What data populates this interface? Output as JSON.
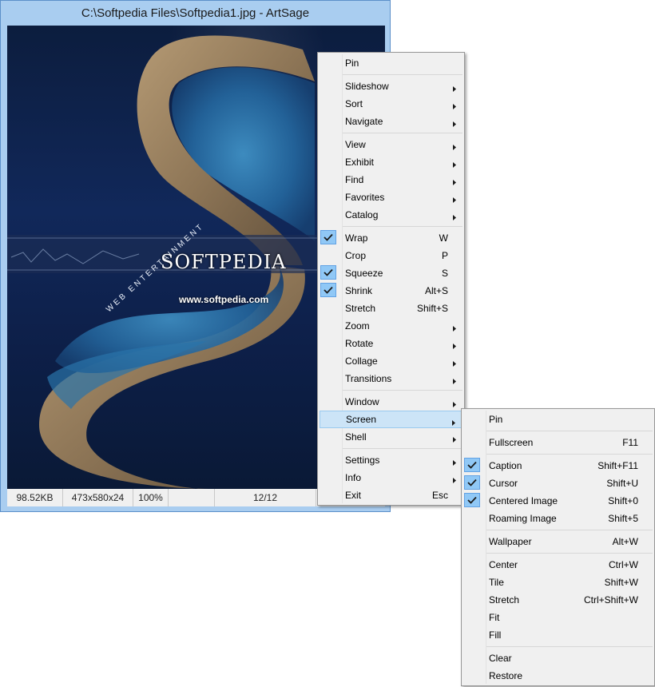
{
  "window": {
    "title": "C:\\Softpedia Files\\Softpedia1.jpg - ArtSage"
  },
  "image": {
    "brand": "SOFTPEDIA",
    "url": "www.softpedia.com",
    "tag": "WEB ENTERTAINMENT"
  },
  "statusbar": {
    "size": "98.52KB",
    "dimensions": "473x580x24",
    "zoom": "100%",
    "blank": "",
    "index": "12/12",
    "extra": "!"
  },
  "main_menu": {
    "items": [
      {
        "label": "Pin",
        "accel": "",
        "submenu": false,
        "checked": false
      },
      {
        "sep": true
      },
      {
        "label": "Slideshow",
        "accel": "",
        "submenu": true,
        "checked": false
      },
      {
        "label": "Sort",
        "accel": "",
        "submenu": true,
        "checked": false
      },
      {
        "label": "Navigate",
        "accel": "",
        "submenu": true,
        "checked": false
      },
      {
        "sep": true
      },
      {
        "label": "View",
        "accel": "",
        "submenu": true,
        "checked": false
      },
      {
        "label": "Exhibit",
        "accel": "",
        "submenu": true,
        "checked": false
      },
      {
        "label": "Find",
        "accel": "",
        "submenu": true,
        "checked": false
      },
      {
        "label": "Favorites",
        "accel": "",
        "submenu": true,
        "checked": false
      },
      {
        "label": "Catalog",
        "accel": "",
        "submenu": true,
        "checked": false
      },
      {
        "sep": true
      },
      {
        "label": "Wrap",
        "accel": "W",
        "submenu": false,
        "checked": true
      },
      {
        "label": "Crop",
        "accel": "P",
        "submenu": false,
        "checked": false
      },
      {
        "label": "Squeeze",
        "accel": "S",
        "submenu": false,
        "checked": true
      },
      {
        "label": "Shrink",
        "accel": "Alt+S",
        "submenu": false,
        "checked": true
      },
      {
        "label": "Stretch",
        "accel": "Shift+S",
        "submenu": false,
        "checked": false
      },
      {
        "label": "Zoom",
        "accel": "",
        "submenu": true,
        "checked": false
      },
      {
        "label": "Rotate",
        "accel": "",
        "submenu": true,
        "checked": false
      },
      {
        "label": "Collage",
        "accel": "",
        "submenu": true,
        "checked": false
      },
      {
        "label": "Transitions",
        "accel": "",
        "submenu": true,
        "checked": false
      },
      {
        "sep": true
      },
      {
        "label": "Window",
        "accel": "",
        "submenu": true,
        "checked": false
      },
      {
        "label": "Screen",
        "accel": "",
        "submenu": true,
        "checked": false,
        "selected": true
      },
      {
        "label": "Shell",
        "accel": "",
        "submenu": true,
        "checked": false
      },
      {
        "sep": true
      },
      {
        "label": "Settings",
        "accel": "",
        "submenu": true,
        "checked": false
      },
      {
        "label": "Info",
        "accel": "",
        "submenu": true,
        "checked": false
      },
      {
        "label": "Exit",
        "accel": "Esc",
        "submenu": false,
        "checked": false
      }
    ]
  },
  "screen_menu": {
    "items": [
      {
        "label": "Pin",
        "accel": "",
        "checked": false
      },
      {
        "sep": true
      },
      {
        "label": "Fullscreen",
        "accel": "F11",
        "checked": false
      },
      {
        "sep": true
      },
      {
        "label": "Caption",
        "accel": "Shift+F11",
        "checked": true
      },
      {
        "label": "Cursor",
        "accel": "Shift+U",
        "checked": true
      },
      {
        "label": "Centered Image",
        "accel": "Shift+0",
        "checked": true
      },
      {
        "label": "Roaming Image",
        "accel": "Shift+5",
        "checked": false
      },
      {
        "sep": true
      },
      {
        "label": "Wallpaper",
        "accel": "Alt+W",
        "checked": false
      },
      {
        "sep": true
      },
      {
        "label": "Center",
        "accel": "Ctrl+W",
        "checked": false
      },
      {
        "label": "Tile",
        "accel": "Shift+W",
        "checked": false
      },
      {
        "label": "Stretch",
        "accel": "Ctrl+Shift+W",
        "checked": false
      },
      {
        "label": "Fit",
        "accel": "",
        "checked": false
      },
      {
        "label": "Fill",
        "accel": "",
        "checked": false
      },
      {
        "sep": true
      },
      {
        "label": "Clear",
        "accel": "",
        "checked": false
      },
      {
        "label": "Restore",
        "accel": "",
        "checked": false
      }
    ]
  },
  "colors": {
    "window_frame": "#a9cdf0",
    "menu_bg": "#f0f0f0",
    "highlight": "#cce4f7",
    "check_bg": "#90c8f6"
  }
}
